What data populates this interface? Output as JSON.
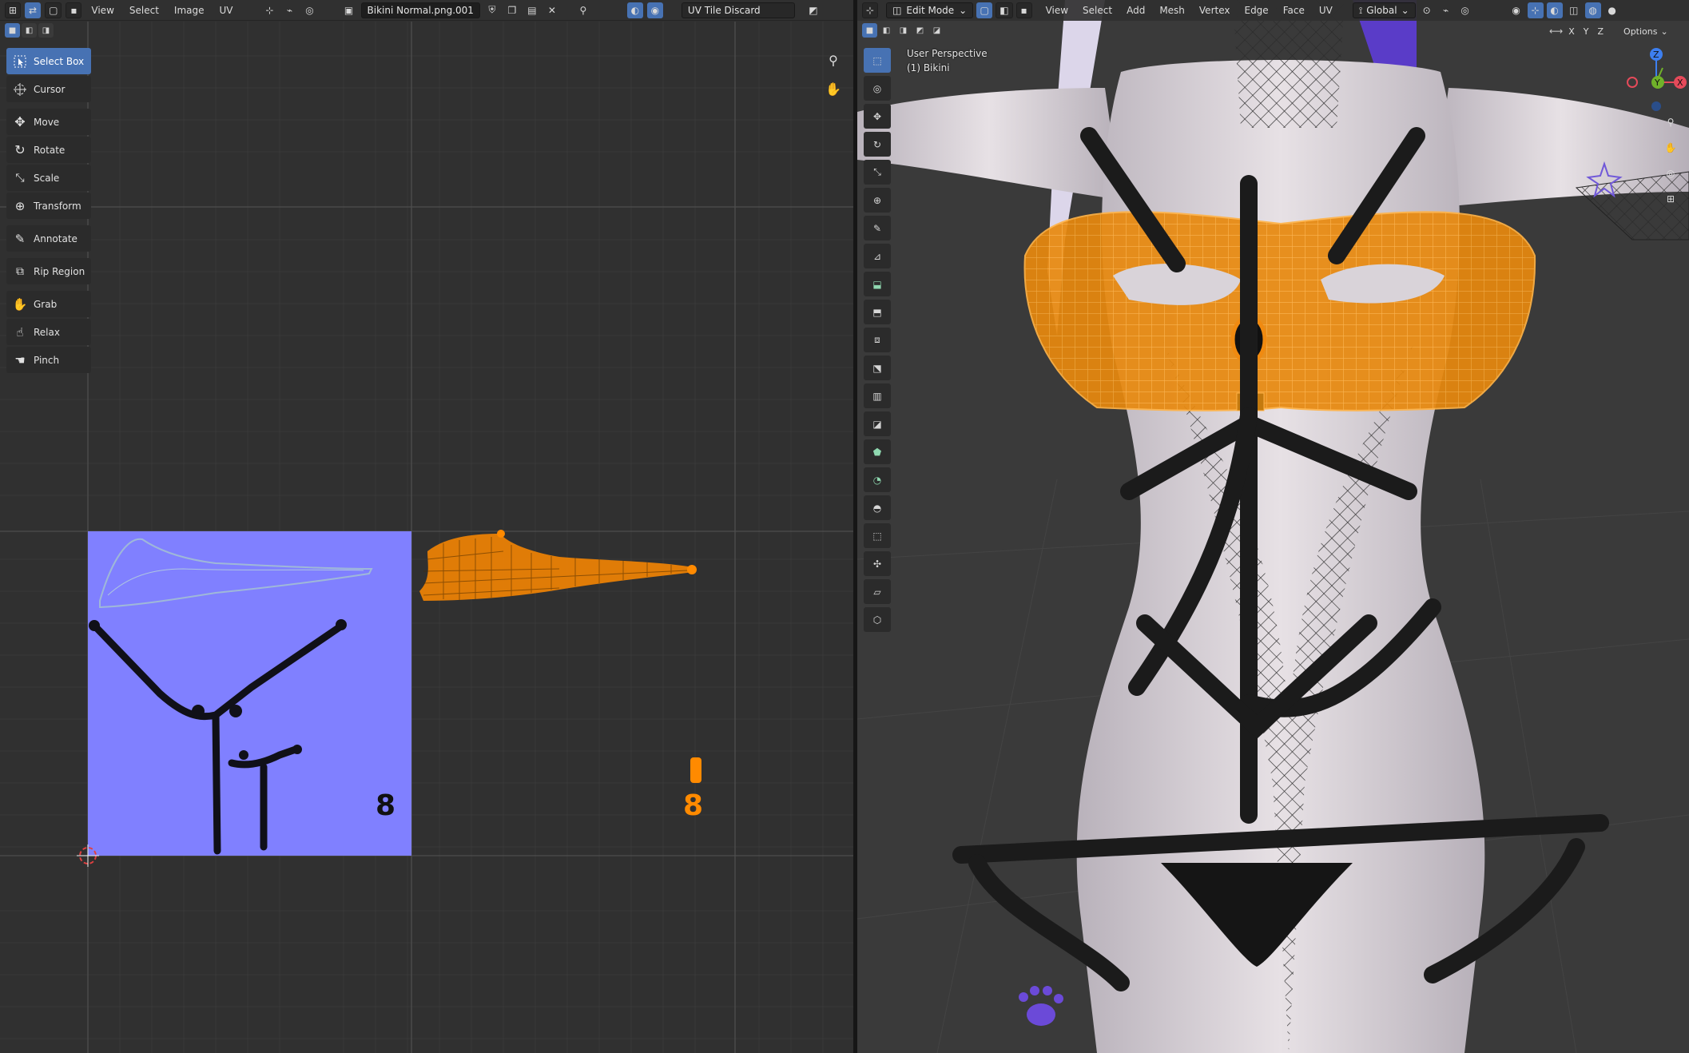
{
  "uv_editor": {
    "menus": [
      "View",
      "Select",
      "Image",
      "UV"
    ],
    "image_name": "Bikini Normal.png.001",
    "uv_option": "UV Tile Discard",
    "tools": [
      {
        "label": "Select Box",
        "icon": "select-box-icon",
        "active": true
      },
      {
        "label": "Cursor",
        "icon": "cursor-icon",
        "active": false
      },
      {
        "label": "Move",
        "icon": "move-icon",
        "active": false
      },
      {
        "label": "Rotate",
        "icon": "rotate-icon",
        "active": false
      },
      {
        "label": "Scale",
        "icon": "scale-icon",
        "active": false
      },
      {
        "label": "Transform",
        "icon": "transform-icon",
        "active": false
      },
      {
        "label": "Annotate",
        "icon": "annotate-icon",
        "active": false
      },
      {
        "label": "Rip Region",
        "icon": "rip-region-icon",
        "active": false
      },
      {
        "label": "Grab",
        "icon": "grab-icon",
        "active": false
      },
      {
        "label": "Relax",
        "icon": "relax-icon",
        "active": false
      },
      {
        "label": "Pinch",
        "icon": "pinch-icon",
        "active": false
      }
    ]
  },
  "viewport": {
    "mode": "Edit Mode",
    "menus": [
      "View",
      "Select",
      "Add",
      "Mesh",
      "Vertex",
      "Edge",
      "Face",
      "UV"
    ],
    "transform_orientation": "Global",
    "options_label": "Options",
    "perspective": "User Perspective",
    "object": "(1) Bikini",
    "axes": [
      "X",
      "Y",
      "Z"
    ]
  },
  "colors": {
    "accent": "#4772b3",
    "selection": "#ff8a00",
    "normal_map": "#8080ff",
    "gizmo_x": "#e54a5a",
    "gizmo_y": "#70b22a",
    "gizmo_z": "#3d7ff0"
  }
}
